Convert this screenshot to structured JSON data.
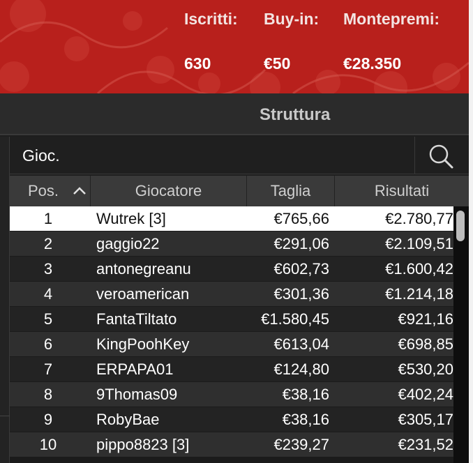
{
  "header": {
    "stats": [
      {
        "label": "Iscritti:",
        "value": "630"
      },
      {
        "label": "Buy-in:",
        "value": "€50"
      },
      {
        "label": "Montepremi:",
        "value": "€28.350"
      }
    ],
    "accent_color": "#b8201c"
  },
  "tabs": {
    "struttura": "Struttura"
  },
  "search": {
    "value": "Gioc.",
    "icon": "search-icon"
  },
  "table": {
    "columns": [
      "Pos.",
      "Giocatore",
      "Taglia",
      "Risultati"
    ],
    "sort_icon": "chevron-up-icon",
    "rows": [
      {
        "pos": "1",
        "name": "Wutrek [3]",
        "size": "€765,66",
        "result": "€2.780,77"
      },
      {
        "pos": "2",
        "name": "gaggio22",
        "size": "€291,06",
        "result": "€2.109,51"
      },
      {
        "pos": "3",
        "name": "antonegreanu",
        "size": "€602,73",
        "result": "€1.600,42"
      },
      {
        "pos": "4",
        "name": "veroamerican",
        "size": "€301,36",
        "result": "€1.214,18"
      },
      {
        "pos": "5",
        "name": "FantaTiltato",
        "size": "€1.580,45",
        "result": "€921,16"
      },
      {
        "pos": "6",
        "name": "KingPoohKey",
        "size": "€613,04",
        "result": "€698,85"
      },
      {
        "pos": "7",
        "name": "ERPAPA01",
        "size": "€124,80",
        "result": "€530,20"
      },
      {
        "pos": "8",
        "name": "9Thomas09",
        "size": "€38,16",
        "result": "€402,24"
      },
      {
        "pos": "9",
        "name": "RobyBae",
        "size": "€38,16",
        "result": "€305,17"
      },
      {
        "pos": "10",
        "name": "pippo8823 [3]",
        "size": "€239,27",
        "result": "€231,52"
      }
    ]
  }
}
